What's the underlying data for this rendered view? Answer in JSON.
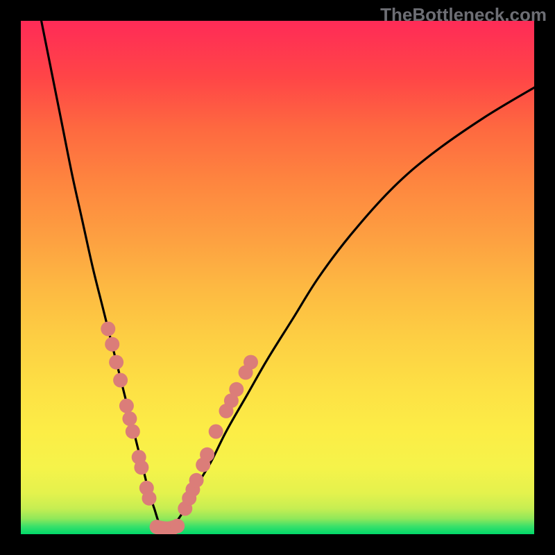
{
  "watermark": "TheBottleneck.com",
  "colors": {
    "frame": "#000000",
    "gradient_top": "#ff2b57",
    "gradient_bottom": "#00d96a",
    "curve": "#000000",
    "marker_fill": "#db7d79",
    "marker_stroke": "#c96a67"
  },
  "chart_data": {
    "type": "line",
    "title": "",
    "xlabel": "",
    "ylabel": "",
    "xlim": [
      0,
      100
    ],
    "ylim": [
      0,
      100
    ],
    "grid": false,
    "series": [
      {
        "name": "bottleneck-curve",
        "x": [
          4,
          6,
          8,
          10,
          12,
          14,
          16,
          18,
          19,
          20,
          21,
          22,
          23,
          24,
          25,
          26,
          27,
          28,
          29,
          30,
          32,
          34,
          37,
          40,
          44,
          48,
          53,
          58,
          64,
          72,
          80,
          90,
          100
        ],
        "y": [
          100,
          90,
          80,
          70,
          61,
          52,
          44,
          36,
          32,
          28,
          24,
          20,
          16,
          12,
          8,
          5,
          2,
          1,
          1,
          2,
          5,
          9,
          14,
          20,
          27,
          34,
          42,
          50,
          58,
          67,
          74,
          81,
          87
        ]
      }
    ],
    "markers": {
      "left_branch": [
        {
          "x": 17.0,
          "y": 40.0
        },
        {
          "x": 17.8,
          "y": 37.0
        },
        {
          "x": 18.6,
          "y": 33.5
        },
        {
          "x": 19.4,
          "y": 30.0
        },
        {
          "x": 20.6,
          "y": 25.0
        },
        {
          "x": 21.2,
          "y": 22.5
        },
        {
          "x": 21.8,
          "y": 20.0
        },
        {
          "x": 23.0,
          "y": 15.0
        },
        {
          "x": 23.5,
          "y": 13.0
        },
        {
          "x": 24.5,
          "y": 9.0
        },
        {
          "x": 25.0,
          "y": 7.0
        }
      ],
      "bottom": [
        {
          "x": 26.5,
          "y": 1.4
        },
        {
          "x": 27.3,
          "y": 1.2
        },
        {
          "x": 28.1,
          "y": 1.1
        },
        {
          "x": 28.9,
          "y": 1.1
        },
        {
          "x": 29.7,
          "y": 1.3
        },
        {
          "x": 30.5,
          "y": 1.6
        }
      ],
      "right_branch": [
        {
          "x": 32.0,
          "y": 5.0
        },
        {
          "x": 32.8,
          "y": 7.0
        },
        {
          "x": 33.5,
          "y": 8.7
        },
        {
          "x": 34.2,
          "y": 10.5
        },
        {
          "x": 35.5,
          "y": 13.5
        },
        {
          "x": 36.3,
          "y": 15.5
        },
        {
          "x": 38.0,
          "y": 20.0
        },
        {
          "x": 40.0,
          "y": 24.0
        },
        {
          "x": 41.0,
          "y": 26.0
        },
        {
          "x": 42.0,
          "y": 28.2
        },
        {
          "x": 43.8,
          "y": 31.5
        },
        {
          "x": 44.8,
          "y": 33.5
        }
      ]
    }
  }
}
